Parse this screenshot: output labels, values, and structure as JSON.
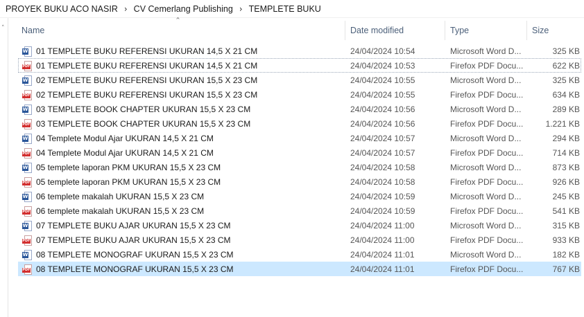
{
  "breadcrumb": [
    "PROYEK BUKU ACO NASIR",
    "CV Cemerlang Publishing",
    "TEMPLETE BUKU"
  ],
  "columns": {
    "name": "Name",
    "date": "Date modified",
    "type": "Type",
    "size": "Size"
  },
  "files": [
    {
      "name": "01 TEMPLETE BUKU REFERENSI UKURAN 14,5 X 21 CM",
      "date": "24/04/2024 10:54",
      "type": "Microsoft Word D...",
      "size": "325 KB",
      "icon": "word-doc-icon"
    },
    {
      "name": "01 TEMPLETE BUKU REFERENSI UKURAN 14,5 X 21 CM",
      "date": "24/04/2024 10:53",
      "type": "Firefox PDF Docu...",
      "size": "622 KB",
      "icon": "pdf-doc-icon"
    },
    {
      "name": "02 TEMPLETE BUKU REFERENSI UKURAN 15,5 X 23 CM",
      "date": "24/04/2024 10:55",
      "type": "Microsoft Word D...",
      "size": "325 KB",
      "icon": "word-doc-icon"
    },
    {
      "name": "02 TEMPLETE BUKU REFERENSI UKURAN 15,5 X 23 CM",
      "date": "24/04/2024 10:55",
      "type": "Firefox PDF Docu...",
      "size": "634 KB",
      "icon": "pdf-doc-icon"
    },
    {
      "name": "03 TEMPLETE BOOK CHAPTER  UKURAN 15,5 X 23 CM",
      "date": "24/04/2024 10:56",
      "type": "Microsoft Word D...",
      "size": "289 KB",
      "icon": "word-doc-icon"
    },
    {
      "name": "03 TEMPLETE BOOK CHAPTER  UKURAN 15,5 X 23 CM",
      "date": "24/04/2024 10:56",
      "type": "Firefox PDF Docu...",
      "size": "1.221 KB",
      "icon": "pdf-doc-icon"
    },
    {
      "name": "04 Templete  Modul Ajar UKURAN 14,5 X 21 CM",
      "date": "24/04/2024 10:57",
      "type": "Microsoft Word D...",
      "size": "294 KB",
      "icon": "word-doc-icon"
    },
    {
      "name": "04 Templete  Modul Ajar UKURAN 14,5 X 21 CM",
      "date": "24/04/2024 10:57",
      "type": "Firefox PDF Docu...",
      "size": "714 KB",
      "icon": "pdf-doc-icon"
    },
    {
      "name": "05 templete laporan PKM UKURAN 15,5 X 23 CM",
      "date": "24/04/2024 10:58",
      "type": "Microsoft Word D...",
      "size": "873 KB",
      "icon": "word-doc-icon"
    },
    {
      "name": "05 templete laporan PKM UKURAN 15,5 X 23 CM",
      "date": "24/04/2024 10:58",
      "type": "Firefox PDF Docu...",
      "size": "926 KB",
      "icon": "pdf-doc-icon"
    },
    {
      "name": "06 templete makalah UKURAN 15,5 X 23 CM",
      "date": "24/04/2024 10:59",
      "type": "Microsoft Word D...",
      "size": "245 KB",
      "icon": "word-doc-icon"
    },
    {
      "name": "06 templete makalah UKURAN 15,5 X 23 CM",
      "date": "24/04/2024 10:59",
      "type": "Firefox PDF Docu...",
      "size": "541 KB",
      "icon": "pdf-doc-icon"
    },
    {
      "name": "07 TEMPLETE BUKU AJAR UKURAN 15,5 X 23 CM",
      "date": "24/04/2024 11:00",
      "type": "Microsoft Word D...",
      "size": "315 KB",
      "icon": "word-doc-icon"
    },
    {
      "name": "07 TEMPLETE BUKU AJAR UKURAN 15,5 X 23 CM",
      "date": "24/04/2024 11:00",
      "type": "Firefox PDF Docu...",
      "size": "933 KB",
      "icon": "pdf-doc-icon"
    },
    {
      "name": "08 TEMPLETE MONOGRAF  UKURAN 15,5 X 23 CM",
      "date": "24/04/2024 11:01",
      "type": "Microsoft Word D...",
      "size": "182 KB",
      "icon": "word-doc-icon"
    },
    {
      "name": "08 TEMPLETE MONOGRAF  UKURAN 15,5 X 23 CM",
      "date": "24/04/2024 11:01",
      "type": "Firefox PDF Docu...",
      "size": "767 KB",
      "icon": "pdf-doc-icon"
    }
  ],
  "focused_index": 1,
  "selected_index": 15,
  "icons": {
    "separator": "chevron-right-icon",
    "sort": "sort-ascending-icon",
    "nav": "chevron-up-icon"
  },
  "colors": {
    "selection": "#cce8ff",
    "header_text": "#4c607a",
    "word": "#2b579a",
    "pdf": "#d32f2f"
  }
}
